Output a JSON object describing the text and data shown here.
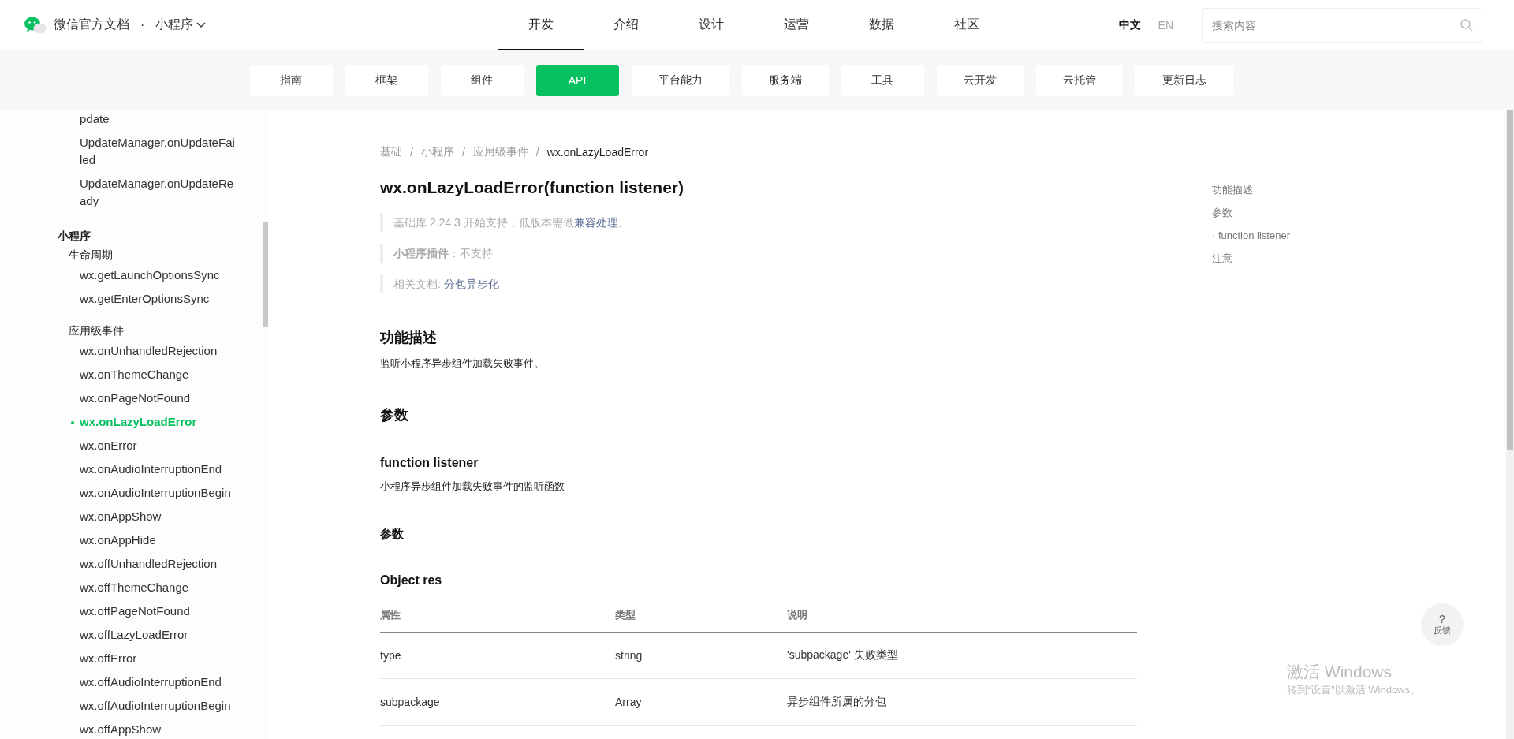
{
  "header": {
    "brand": "微信官方文档",
    "separator": "·",
    "product": "小程序",
    "nav": [
      {
        "label": "开发",
        "selected": true
      },
      {
        "label": "介绍",
        "selected": false
      },
      {
        "label": "设计",
        "selected": false
      },
      {
        "label": "运营",
        "selected": false
      },
      {
        "label": "数据",
        "selected": false
      },
      {
        "label": "社区",
        "selected": false
      }
    ],
    "languages": [
      {
        "label": "中文",
        "selected": true
      },
      {
        "label": "EN",
        "selected": false
      }
    ],
    "search": {
      "placeholder": "搜索内容"
    }
  },
  "subnav": [
    {
      "label": "指南",
      "selected": false
    },
    {
      "label": "框架",
      "selected": false
    },
    {
      "label": "组件",
      "selected": false
    },
    {
      "label": "API",
      "selected": true
    },
    {
      "label": "平台能力",
      "selected": false
    },
    {
      "label": "服务端",
      "selected": false
    },
    {
      "label": "工具",
      "selected": false
    },
    {
      "label": "云开发",
      "selected": false
    },
    {
      "label": "云托管",
      "selected": false
    },
    {
      "label": "更新日志",
      "selected": false
    }
  ],
  "sidebar": {
    "items": [
      {
        "kind": "leaf",
        "label": "pdate",
        "selected": false
      },
      {
        "kind": "leaf",
        "label": "UpdateManager.onUpdateFailed",
        "selected": false
      },
      {
        "kind": "leaf",
        "label": "UpdateManager.onUpdateReady",
        "selected": false
      },
      {
        "kind": "group",
        "label": "小程序",
        "children": [
          {
            "kind": "section",
            "label": "生命周期",
            "children": [
              {
                "kind": "leaf",
                "label": "wx.getLaunchOptionsSync",
                "selected": false
              },
              {
                "kind": "leaf",
                "label": "wx.getEnterOptionsSync",
                "selected": false
              }
            ]
          },
          {
            "kind": "section",
            "label": "应用级事件",
            "children": [
              {
                "kind": "leaf",
                "label": "wx.onUnhandledRejection",
                "selected": false
              },
              {
                "kind": "leaf",
                "label": "wx.onThemeChange",
                "selected": false
              },
              {
                "kind": "leaf",
                "label": "wx.onPageNotFound",
                "selected": false
              },
              {
                "kind": "leaf",
                "label": "wx.onLazyLoadError",
                "selected": true
              },
              {
                "kind": "leaf",
                "label": "wx.onError",
                "selected": false
              },
              {
                "kind": "leaf",
                "label": "wx.onAudioInterruptionEnd",
                "selected": false
              },
              {
                "kind": "leaf",
                "label": "wx.onAudioInterruptionBegin",
                "selected": false
              },
              {
                "kind": "leaf",
                "label": "wx.onAppShow",
                "selected": false
              },
              {
                "kind": "leaf",
                "label": "wx.onAppHide",
                "selected": false
              },
              {
                "kind": "leaf",
                "label": "wx.offUnhandledRejection",
                "selected": false
              },
              {
                "kind": "leaf",
                "label": "wx.offThemeChange",
                "selected": false
              },
              {
                "kind": "leaf",
                "label": "wx.offPageNotFound",
                "selected": false
              },
              {
                "kind": "leaf",
                "label": "wx.offLazyLoadError",
                "selected": false
              },
              {
                "kind": "leaf",
                "label": "wx.offError",
                "selected": false
              },
              {
                "kind": "leaf",
                "label": "wx.offAudioInterruptionEnd",
                "selected": false
              },
              {
                "kind": "leaf",
                "label": "wx.offAudioInterruptionBegin",
                "selected": false
              },
              {
                "kind": "leaf",
                "label": "wx.offAppShow",
                "selected": false
              }
            ]
          }
        ]
      }
    ]
  },
  "breadcrumb": {
    "separator": "/",
    "items": [
      {
        "label": "基础",
        "current": false
      },
      {
        "label": "小程序",
        "current": false
      },
      {
        "label": "应用级事件",
        "current": false
      },
      {
        "label": "wx.onLazyLoadError",
        "current": true
      }
    ]
  },
  "title": "wx.onLazyLoadError(function listener)",
  "notes": [
    [
      {
        "kind": "plain",
        "text": "基础库 2.24.3 开始支持，低版本需做"
      },
      {
        "kind": "link",
        "text": "兼容处理"
      },
      {
        "kind": "plain",
        "text": "。"
      }
    ],
    [
      {
        "kind": "plain",
        "text": "**小程序插件**：不支持"
      }
    ],
    [
      {
        "kind": "plain",
        "text": "相关文档: "
      },
      {
        "kind": "link",
        "text": "分包异步化"
      }
    ]
  ],
  "content": [
    {
      "kind": "h2",
      "text": "功能描述"
    },
    {
      "kind": "p",
      "text": "监听小程序异步组件加载失败事件。"
    },
    {
      "kind": "h2",
      "text": "参数"
    },
    {
      "kind": "h3",
      "text": "function listener"
    },
    {
      "kind": "p",
      "text": "小程序异步组件加载失败事件的监听函数"
    },
    {
      "kind": "h4",
      "text": "参数"
    },
    {
      "kind": "h3",
      "text": "Object res"
    },
    {
      "kind": "table",
      "columns": [
        "属性",
        "类型",
        "说明"
      ],
      "rows": [
        [
          "type",
          "string",
          "'subpackage' 失败类型"
        ],
        [
          "subpackage",
          "Array",
          "异步组件所属的分包"
        ]
      ]
    }
  ],
  "toc": [
    {
      "label": "功能描述"
    },
    {
      "label": "参数"
    },
    {
      "label": "· function listener"
    },
    {
      "label": "注意"
    }
  ],
  "feedback": {
    "icon": "?",
    "label": "反馈"
  },
  "os_notice": {
    "title": "激活 Windows",
    "subtitle": "转到“设置”以激活 Windows。"
  }
}
